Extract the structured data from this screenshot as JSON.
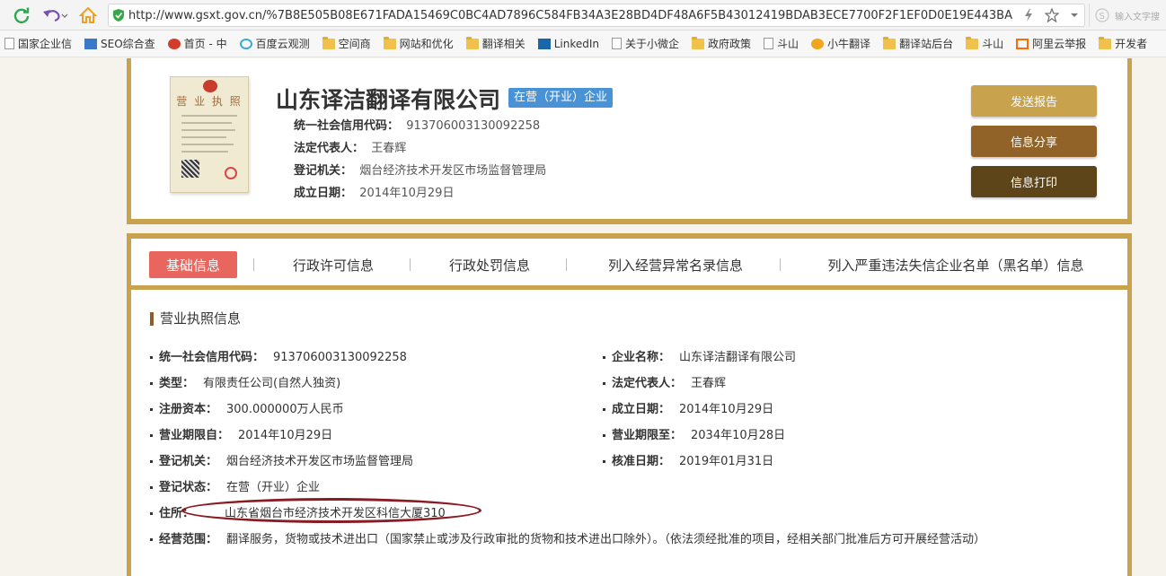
{
  "browser": {
    "url": "http://www.gsxt.gov.cn/%7B8E505B08E671FADA15469C0BC4AD7896C584FB34A3E28BD4DF48A6F5B43012419BDAB3ECE7700F2F1EF0D0E19E443BA",
    "search_placeholder": "输入文字搜",
    "bookmarks": [
      "国家企业信",
      "SEO综合查",
      "首页 - 中",
      "百度云观测",
      "空间商",
      "网站和优化",
      "翻译相关",
      "LinkedIn",
      "关于小微企",
      "政府政策",
      "斗山",
      "小牛翻译",
      "翻译站后台",
      "斗山",
      "阿里云举报",
      "开发者"
    ]
  },
  "company": {
    "name": "山东译洁翻译有限公司",
    "status": "在营（开业）企业",
    "credit_code_label": "统一社会信用代码：",
    "credit_code": "913706003130092258",
    "legal_rep_label": "法定代表人：",
    "legal_rep": "王春辉",
    "reg_authority_label": "登记机关：",
    "reg_authority": "烟台经济技术开发区市场监督管理局",
    "founded_label": "成立日期：",
    "founded": "2014年10月29日",
    "license_image_title": "营 业 执 照"
  },
  "actions": {
    "send_report": "发送报告",
    "share": "信息分享",
    "print": "信息打印"
  },
  "tabs": [
    "基础信息",
    "行政许可信息",
    "行政处罚信息",
    "列入经营异常名录信息",
    "列入严重违法失信企业名单（黑名单）信息"
  ],
  "license_section": {
    "title": "营业执照信息",
    "left": [
      {
        "label": "统一社会信用代码：",
        "value": "913706003130092258"
      },
      {
        "label": "类型：",
        "value": "有限责任公司(自然人独资)"
      },
      {
        "label": "注册资本：",
        "value": "300.000000万人民币"
      },
      {
        "label": "营业期限自：",
        "value": "2014年10月29日"
      },
      {
        "label": "登记机关：",
        "value": "烟台经济技术开发区市场监督管理局"
      },
      {
        "label": "登记状态：",
        "value": "在营（开业）企业"
      },
      {
        "label": "住所：",
        "value": "山东省烟台市经济技术开发区科信大厦310"
      },
      {
        "label": "经营范围：",
        "value": "翻译服务，货物或技术进出口（国家禁止或涉及行政审批的货物和技术进出口除外）。（依法须经批准的项目，经相关部门批准后方可开展经营活动）"
      }
    ],
    "right": [
      {
        "label": "企业名称：",
        "value": "山东译洁翻译有限公司"
      },
      {
        "label": "法定代表人：",
        "value": "王春辉"
      },
      {
        "label": "成立日期：",
        "value": "2014年10月29日"
      },
      {
        "label": "营业期限至：",
        "value": "2034年10月28日"
      },
      {
        "label": "核准日期：",
        "value": "2019年01月31日"
      }
    ]
  }
}
